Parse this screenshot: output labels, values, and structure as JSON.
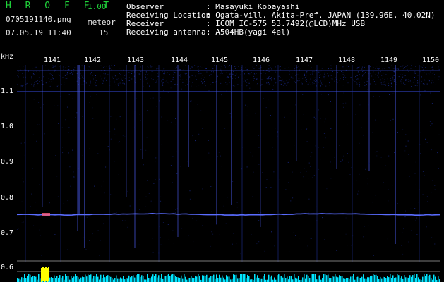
{
  "header": {
    "brand": "H R O F F T",
    "version": "1.00",
    "filename": "0705191140.png",
    "datetime": "07.05.19 11:40",
    "meteor_label": "meteor",
    "meteor_count": "15",
    "info": [
      {
        "label": "Observer",
        "value": ": Masayuki Kobayashi"
      },
      {
        "label": "Receiving Location",
        "value": ": Ogata-vill. Akita-Pref. JAPAN (139.96E, 40.02N)"
      },
      {
        "label": "Receiver",
        "value": ": ICOM IC-575 53.7492(@LCD)MHz USB"
      },
      {
        "label": "Receiving antenna",
        "value": ": A504HB(yagi 4el)"
      }
    ]
  },
  "axis": {
    "y_unit": "kHz",
    "time_ticks": [
      "1141",
      "1142",
      "1143",
      "1144",
      "1145",
      "1146",
      "1147",
      "1148",
      "1149",
      "1150"
    ],
    "freq_ticks": [
      "1.1",
      "1.0",
      "0.9",
      "0.8",
      "0.7",
      "0.6"
    ]
  },
  "colors": {
    "background": "#000000",
    "noise": "#1a2a8c",
    "carrier": "#5a6cff",
    "baseline": "#00e5ff",
    "highlight": "#ffff00",
    "brand": "#1fd23a"
  }
}
